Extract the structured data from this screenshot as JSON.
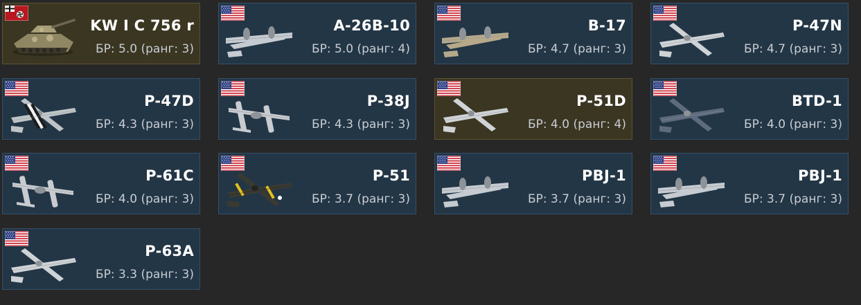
{
  "br_prefix": "БР: ",
  "rank_prefix": " (ранг: ",
  "rank_suffix": ")",
  "vehicles": [
    {
      "name": "KW I C 756 r",
      "br": "5.0",
      "rank": "3",
      "nation": "germany",
      "kind": "tank",
      "premium": true
    },
    {
      "name": "A-26B-10",
      "br": "5.0",
      "rank": "4",
      "nation": "usa",
      "kind": "bomber",
      "premium": false
    },
    {
      "name": "B-17",
      "br": "4.7",
      "rank": "3",
      "nation": "usa",
      "kind": "heavy-bomber",
      "premium": false
    },
    {
      "name": "P-47N",
      "br": "4.7",
      "rank": "3",
      "nation": "usa",
      "kind": "fighter",
      "premium": false
    },
    {
      "name": "P-47D",
      "br": "4.3",
      "rank": "3",
      "nation": "usa",
      "kind": "fighter-striped",
      "premium": false
    },
    {
      "name": "P-38J",
      "br": "4.3",
      "rank": "3",
      "nation": "usa",
      "kind": "twin-boom",
      "premium": false
    },
    {
      "name": "P-51D",
      "br": "4.0",
      "rank": "4",
      "nation": "usa",
      "kind": "fighter",
      "premium": true
    },
    {
      "name": "BTD-1",
      "br": "4.0",
      "rank": "3",
      "nation": "usa",
      "kind": "navy-fighter",
      "premium": false
    },
    {
      "name": "P-61C",
      "br": "4.0",
      "rank": "3",
      "nation": "usa",
      "kind": "twin-boom",
      "premium": false
    },
    {
      "name": "P-51",
      "br": "3.7",
      "rank": "3",
      "nation": "usa",
      "kind": "fighter-dark",
      "premium": false
    },
    {
      "name": "PBJ-1",
      "br": "3.7",
      "rank": "3",
      "nation": "usa",
      "kind": "bomber",
      "premium": false
    },
    {
      "name": "PBJ-1",
      "br": "3.7",
      "rank": "3",
      "nation": "usa",
      "kind": "bomber",
      "premium": false
    },
    {
      "name": "P-63A",
      "br": "3.3",
      "rank": "3",
      "nation": "usa",
      "kind": "fighter",
      "premium": false
    }
  ],
  "colors": {
    "card_bg": "#233646",
    "card_border": "#34506a",
    "premium_bg": "#3b3622",
    "premium_border": "#5c5233",
    "page_bg": "#272727"
  }
}
